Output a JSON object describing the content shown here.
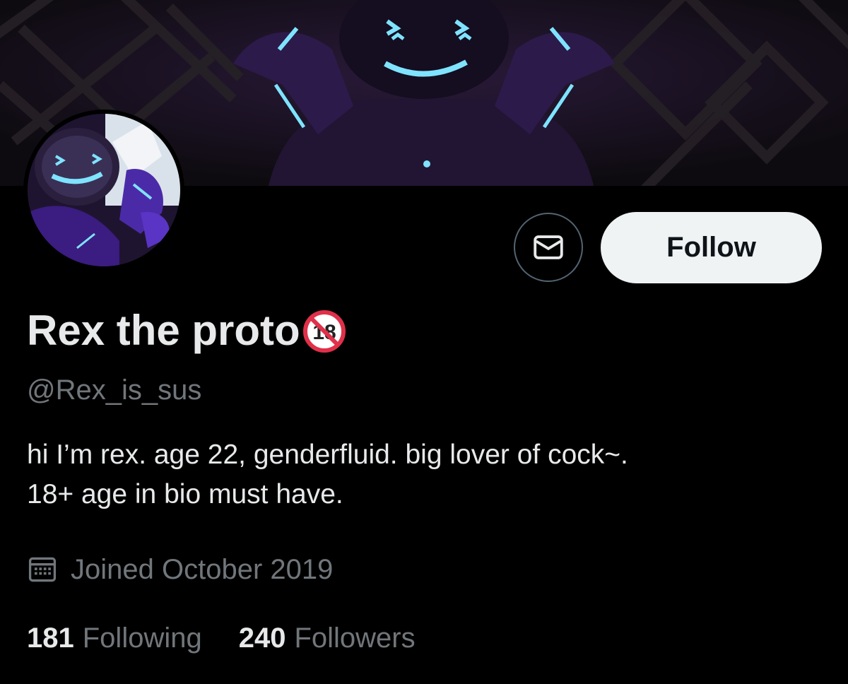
{
  "profile": {
    "display_name": "Rex the proto",
    "name_badge": "18",
    "handle": "@Rex_is_sus",
    "bio_lines": [
      "hi I’m rex. age 22, genderfluid. big lover of cock~.",
      "18+ age in bio must have."
    ],
    "joined": "Joined October 2019"
  },
  "actions": {
    "message_icon": "envelope-icon",
    "follow_label": "Follow"
  },
  "stats": {
    "following_count": "181",
    "following_label": "Following",
    "followers_count": "240",
    "followers_label": "Followers"
  },
  "colors": {
    "background": "#000000",
    "text_primary": "#e7e9ea",
    "text_secondary": "#71767b",
    "button_bg": "#eff3f4",
    "button_text": "#0f1419",
    "accent_glow": "#7fe3ff",
    "banner_purple": "#3a1f66"
  }
}
